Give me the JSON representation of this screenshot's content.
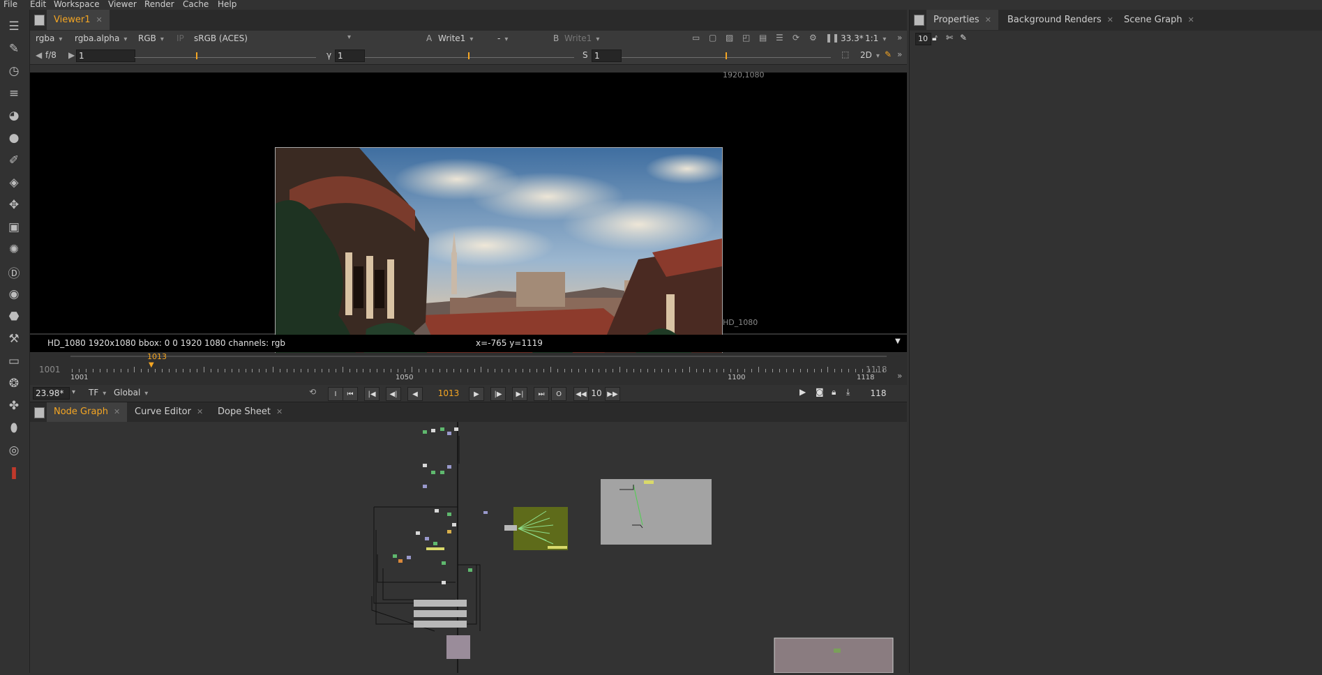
{
  "menu": [
    "File",
    "Edit",
    "Workspace",
    "Viewer",
    "Render",
    "Cache",
    "Help"
  ],
  "viewer": {
    "tab_label": "Viewer1",
    "channels": "rgba",
    "layer": "rgba.alpha",
    "display_channels": "RGB",
    "ip_label": "IP",
    "colorspace": "sRGB (ACES)",
    "a_label": "A",
    "a_input": "Write1",
    "wipe": "-",
    "b_label": "B",
    "b_input": "Write1",
    "zoom": "33.3*",
    "ratio": "1:1",
    "fstop": "f/8",
    "gain": "1",
    "gamma_label": "γ",
    "gamma": "1",
    "saturation_label": "S",
    "saturation": "1",
    "view_mode": "2D",
    "format_size": "1920,1080",
    "format_name": "HD_1080",
    "info_text": "HD_1080 1920x1080  bbox: 0 0 1920 1080 channels: rgb",
    "coords_text": "x=-765 y=1119",
    "gain_ticks": [
      "0.0125",
      "0.1",
      "0.2",
      "1",
      "2",
      "10",
      "20",
      "4"
    ],
    "gamma_ticks": [
      "0",
      "0.1",
      "0.2",
      "0.4",
      "0.7",
      "1",
      "2",
      "3",
      "4"
    ],
    "sat_ticks": [
      "0",
      "0.1",
      "0.2",
      "0.4",
      "0.7",
      "1",
      "2",
      "3",
      "4"
    ]
  },
  "timeline": {
    "start": "1001",
    "end": "1118",
    "current": "1013",
    "ruler_labels": [
      "1001",
      "1050",
      "1100",
      "1118"
    ],
    "fps": "23.98*",
    "tf": "TF",
    "range_mode": "Global",
    "frame_field": "1013",
    "step": "10",
    "frame_count": "118",
    "in_label": "I",
    "out_label": "O"
  },
  "graph_tabs": [
    {
      "label": "Node Graph",
      "active": true
    },
    {
      "label": "Curve Editor",
      "active": false
    },
    {
      "label": "Dope Sheet",
      "active": false
    }
  ],
  "right_tabs": [
    {
      "label": "Properties",
      "active": true
    },
    {
      "label": "Background Renders",
      "active": false
    },
    {
      "label": "Scene Graph",
      "active": false
    }
  ],
  "properties": {
    "max_panels": "10"
  },
  "toolbar_icons": [
    "menu-icon",
    "pen-icon",
    "clock-icon",
    "list-icon",
    "color-wheel-icon",
    "circle-icon",
    "brush-icon",
    "layers-icon",
    "move-icon",
    "cube-icon",
    "particle-icon",
    "d-icon",
    "eye-icon",
    "tag-icon",
    "wrench-icon",
    "panel-icon",
    "flame-icon",
    "network-icon",
    "cylinder-icon",
    "target-icon",
    "script-icon"
  ],
  "colors": {
    "accent": "#f5a623",
    "panel_bg": "#323232",
    "viewer_bg": "#000000",
    "backdrop_olive": "#5e6b1a",
    "backdrop_grey": "#a3a3a3",
    "backdrop_mauve": "#9a8c9a"
  }
}
